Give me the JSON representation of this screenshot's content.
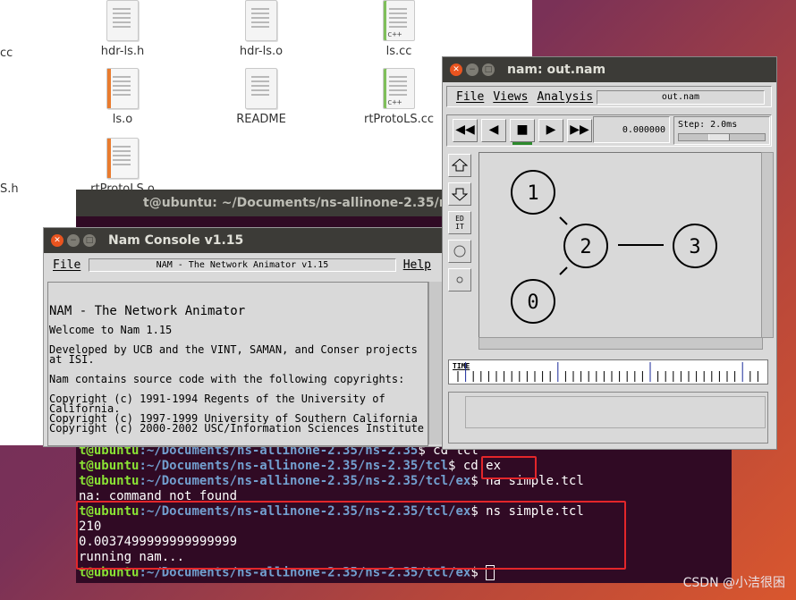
{
  "file_manager": {
    "edge_labels": [
      "cc",
      "S.h"
    ],
    "files": [
      {
        "name": "hdr-ls.h",
        "kind": "text"
      },
      {
        "name": "hdr-ls.o",
        "kind": "text"
      },
      {
        "name": "ls.cc",
        "kind": "cpp"
      },
      {
        "name": "ls.o",
        "kind": "binary"
      },
      {
        "name": "README",
        "kind": "text"
      },
      {
        "name": "rtProtoLS.cc",
        "kind": "cpp"
      },
      {
        "name": "rtProtoLS.o",
        "kind": "binary"
      }
    ]
  },
  "terminal": {
    "title": "t@ubuntu: ~/Documents/ns-allinone-2.35/ns-2.35/tcl/ex",
    "lines": [
      {
        "prompt_user": "t@ubuntu",
        "prompt_path": ":~/Documents/ns-allinone-2.35/ns-2.35",
        "cmd": "$ cd tcl"
      },
      {
        "prompt_user": "t@ubuntu",
        "prompt_path": ":~/Documents/ns-allinone-2.35/ns-2.35/tcl",
        "cmd": "$ cd ex"
      },
      {
        "prompt_user": "t@ubuntu",
        "prompt_path": ":~/Documents/ns-allinone-2.35/ns-2.35/tcl/ex",
        "cmd": "$ na simple.tcl"
      },
      {
        "output": "na: command not found"
      },
      {
        "prompt_user": "t@ubuntu",
        "prompt_path": ":~/Documents/ns-allinone-2.35/ns-2.35/tcl/ex",
        "cmd": "$ ns simple.tcl"
      },
      {
        "output": "210"
      },
      {
        "output": "0.0037499999999999999"
      },
      {
        "output": "running nam..."
      },
      {
        "prompt_user": "t@ubuntu",
        "prompt_path": ":~/Documents/ns-allinone-2.35/ns-2.35/tcl/ex",
        "cmd": "$ "
      }
    ]
  },
  "nam_console": {
    "title": "Nam Console v1.15",
    "menu_file": "File",
    "menu_help": "Help",
    "field": "NAM - The Network Animator v1.15",
    "heading": "NAM - The Network Animator",
    "paragraphs": [
      "Welcome to Nam 1.15",
      "Developed by UCB and the VINT, SAMAN, and Conser projects\nat ISI.",
      "Nam contains source code with the following copyrights:",
      "Copyright (c) 1991-1994 Regents of the University of\nCalifornia.\nCopyright (c) 1997-1999 University of Southern California\nCopyright (c) 2000-2002 USC/Information Sciences Institute"
    ]
  },
  "nam_window": {
    "title": "nam: out.nam",
    "menus": [
      "File",
      "Views",
      "Analysis"
    ],
    "file_field": "out.nam",
    "controls": {
      "rewind": "◀◀",
      "back": "◀",
      "stop": "■",
      "play": "▶",
      "forward": "▶▶"
    },
    "time": "0.000000",
    "step": "Step: 2.0ms",
    "step_slider_fraction": 0.45,
    "tools": {
      "edit": "ED\nIT"
    },
    "timeline_label": "TIME",
    "nodes": [
      "0",
      "1",
      "2",
      "3"
    ]
  },
  "watermark": "CSDN @小洁很困"
}
